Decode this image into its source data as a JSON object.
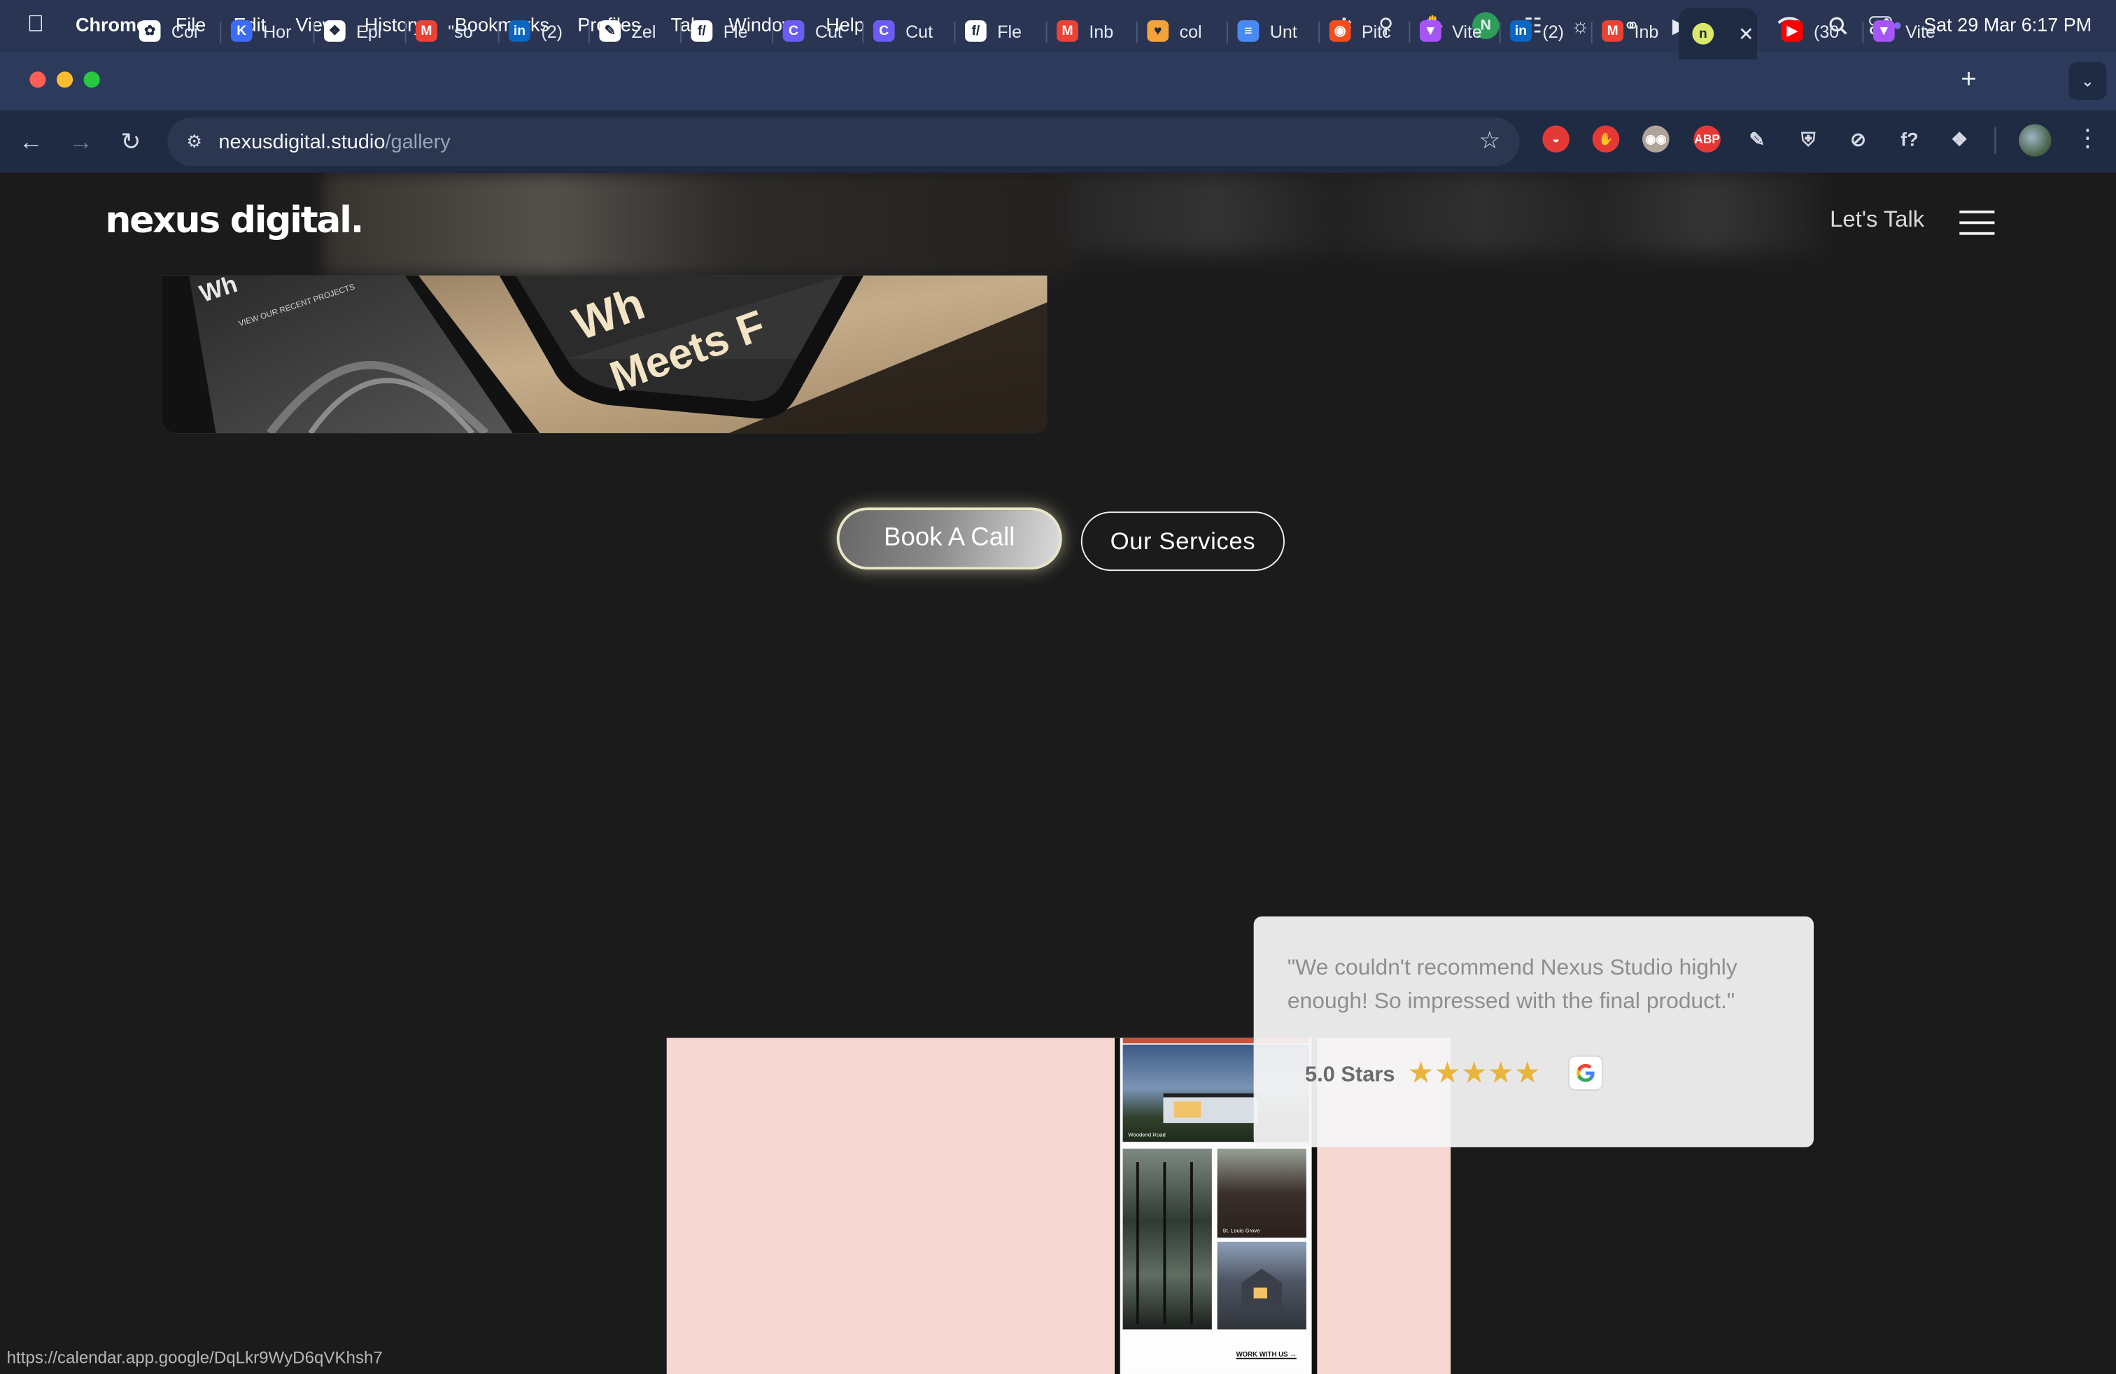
{
  "menubar": {
    "app": "Chrome",
    "items": [
      "File",
      "Edit",
      "View",
      "History",
      "Bookmarks",
      "Profiles",
      "Tab",
      "Window",
      "Help"
    ],
    "status_icons": [
      "figma-icon",
      "key-icon",
      "pin-icon",
      "n-badge-icon",
      "airdrop-icon",
      "brightness-icon",
      "headphones-icon",
      "play-icon",
      "battery-icon",
      "wifi-icon",
      "search-icon",
      "control-center-icon"
    ],
    "clock": "Sat 29 Mar  6:17 PM"
  },
  "tabs": [
    {
      "label": "Coi",
      "icon": "chatgpt-icon",
      "color": "#ffffff"
    },
    {
      "label": "Hor",
      "icon": "k-icon",
      "color": "#3b6cf6"
    },
    {
      "label": "Epi",
      "icon": "grid-icon",
      "color": "#ffffff"
    },
    {
      "label": "\"so",
      "icon": "gmail-icon",
      "color": "#ea4335"
    },
    {
      "label": "(2)",
      "icon": "linkedin-icon",
      "color": "#0a66c2"
    },
    {
      "label": "Zel",
      "icon": "pencil-icon",
      "color": "#ffffff"
    },
    {
      "label": "Fle",
      "icon": "fx-icon",
      "color": "#ffffff"
    },
    {
      "label": "Cut",
      "icon": "c-icon",
      "color": "#6b5cf6"
    },
    {
      "label": "Cut",
      "icon": "c-icon",
      "color": "#6b5cf6"
    },
    {
      "label": "Fle",
      "icon": "fx-icon",
      "color": "#ffffff"
    },
    {
      "label": "Inb",
      "icon": "gmail-icon",
      "color": "#ea4335"
    },
    {
      "label": "col",
      "icon": "heart-icon",
      "color": "#f3a33a"
    },
    {
      "label": "Unt",
      "icon": "docs-icon",
      "color": "#4a8af4"
    },
    {
      "label": "Pitc",
      "icon": "figma-icon",
      "color": "#f24e1e"
    },
    {
      "label": "Vite",
      "icon": "vite-icon",
      "color": "#a855f7"
    },
    {
      "label": "(2)",
      "icon": "linkedin-icon",
      "color": "#0a66c2"
    },
    {
      "label": "Inb",
      "icon": "gmail-icon",
      "color": "#ea4335"
    },
    {
      "label": "",
      "icon": "nexus-icon",
      "color": "#d9e86a",
      "active": true
    },
    {
      "label": "(30",
      "icon": "youtube-icon",
      "color": "#ff0000"
    },
    {
      "label": "Vite",
      "icon": "vite-icon",
      "color": "#a855f7"
    }
  ],
  "toolbar": {
    "url_host": "nexusdigital.studio",
    "url_path": "/gallery",
    "extensions": [
      {
        "name": "pokeball-icon",
        "color": "#e53935",
        "text": ""
      },
      {
        "name": "hand-icon",
        "color": "#e53935",
        "text": ""
      },
      {
        "name": "eyes-icon",
        "color": "#b0a39a",
        "text": ""
      },
      {
        "name": "adblock-icon",
        "color": "#e53935",
        "text": "ABP"
      },
      {
        "name": "picker-icon",
        "color": "#1f2a43",
        "text": ""
      },
      {
        "name": "shield-icon",
        "color": "#1f2a43",
        "text": ""
      },
      {
        "name": "compass-icon",
        "color": "#1f2a43",
        "text": ""
      },
      {
        "name": "font-icon",
        "color": "#1f2a43",
        "text": "f?"
      },
      {
        "name": "puzzle-icon",
        "color": "#1f2a43",
        "text": ""
      }
    ]
  },
  "site": {
    "logo": "nexus digital.",
    "lets_talk": "Let's Talk",
    "book_call": "Book A Call",
    "our_services": "Our Services",
    "hero_text_1": "Wh",
    "hero_text_2": "Meets F",
    "hero_small": "VIEW OUR RECENT PROJECTS",
    "review": {
      "quote": "\"We couldn't recommend Nexus Studio highly enough! So impressed with the final product.\"",
      "rating": "5.0 Stars",
      "stars": 5
    },
    "phone_labels": {
      "label_1": "Woodend Road",
      "label_2": "St. Louis Grove",
      "cta": "WORK WITH US →"
    }
  },
  "status_bar": {
    "url": "https://calendar.app.google/DqLkr9WyD6qVKhsh7"
  },
  "colors": {
    "page_bg": "#1b1b1b",
    "menubar_bg": "#2a3554",
    "tabstrip_bg": "#2c3a5c",
    "toolbar_bg": "#1f2a43",
    "showcase_bg": "#f6d6d1",
    "star": "#e9b53a"
  }
}
